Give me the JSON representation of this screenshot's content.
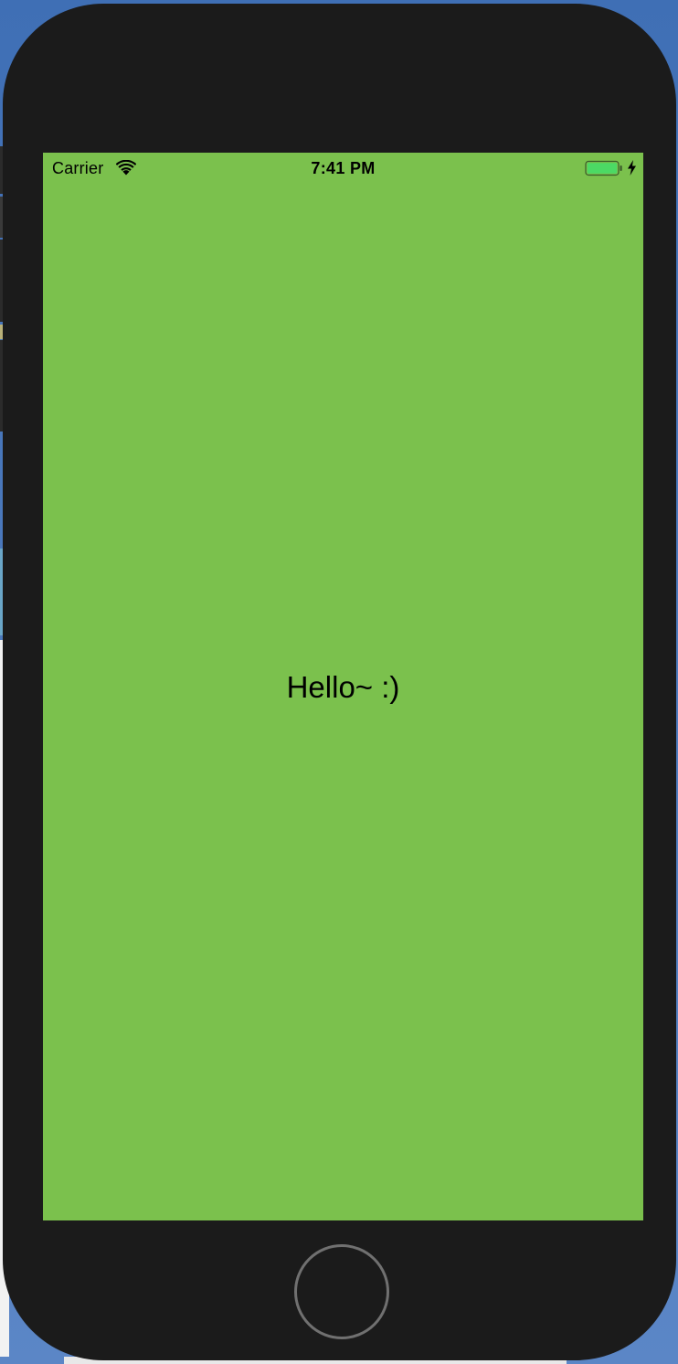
{
  "status_bar": {
    "carrier": "Carrier",
    "time": "7:41 PM",
    "wifi_icon": "wifi-icon",
    "battery_icon": "battery-icon",
    "charging_icon": "bolt-icon",
    "battery_level": 1.0,
    "battery_color": "#4cd964"
  },
  "screen": {
    "greeting": "Hello~ :)",
    "background_color": "#7bc14d"
  },
  "device": {
    "frame_color": "#1b1b1b",
    "home_button_icon": "home-button"
  }
}
